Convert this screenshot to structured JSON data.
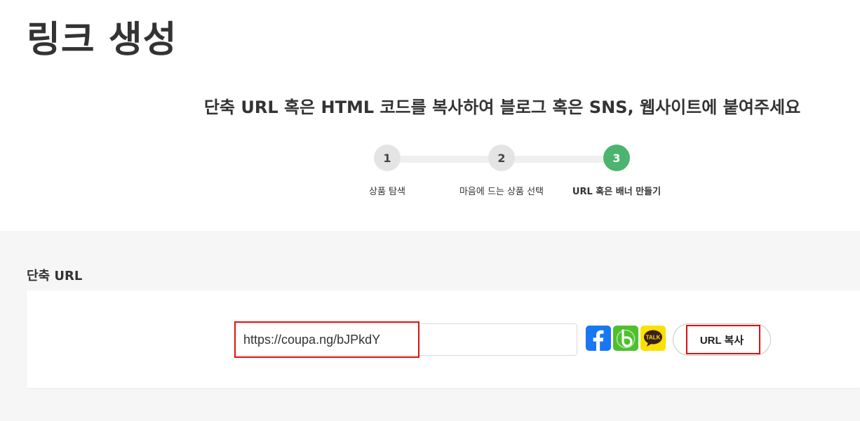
{
  "header": {
    "title": "링크 생성"
  },
  "instructions": {
    "text": "단축 URL 혹은 HTML 코드를 복사하여 블로그 혹은 SNS, 웹사이트에 붙여주세요"
  },
  "steps": [
    {
      "number": "1",
      "label": "상품 탐색"
    },
    {
      "number": "2",
      "label": "마음에 드는 상품 선택"
    },
    {
      "number": "3",
      "label": "URL 혹은 배너 만들기",
      "active": true
    }
  ],
  "short_url": {
    "section_label": "단축 URL",
    "url_value": "https://coupa.ng/bJPkdY",
    "copy_button_label": "URL 복사",
    "share_icons": [
      "facebook-icon",
      "band-icon",
      "kakaotalk-icon"
    ]
  },
  "kakao": {
    "badge_text": "TALK"
  },
  "colors": {
    "active_step": "#4cb46e",
    "highlight": "#e01010",
    "facebook": "#1877f2",
    "band": "#4dc02d",
    "kakao": "#fae100"
  }
}
